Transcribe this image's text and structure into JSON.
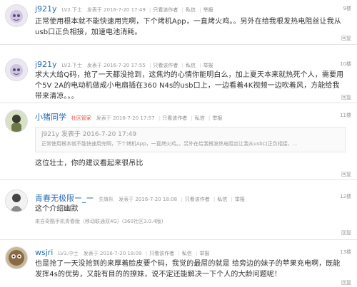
{
  "actions": {
    "only_author": "只看该作者",
    "pm": "私信",
    "report": "举报",
    "reply": "回复"
  },
  "posts": [
    {
      "username": "j921y",
      "level": "LV2.下士",
      "time": "发表于 2016-7-20 17:49",
      "floor": "9楼",
      "content": "正常使用根本就不能快速用完啊，下个烤机App，一直烤火鸡。。另外在给我根发热电阻丝让我从usb口正负相接，加速电池消耗。"
    },
    {
      "username": "j921y",
      "level": "LV2.下士",
      "time": "发表于 2016-7-20 17:55",
      "floor": "10楼",
      "content": "求大大给Q码，抢了一天都没抢到，这焦灼的心情你能明白么，加上夏天本来就热死个人，需要用个5V 2A的电动机做成小电扇插在360 N4s的usb口上，一边看着4K视频一边吹着风，方能给我带来清凉。。。"
    },
    {
      "username": "小猪同学",
      "badge": "社区管家",
      "time": "发表于 2016-7-20 17:57",
      "floor": "11楼",
      "quote_head": "j921y 发表于 2016-7-20 17:49",
      "quote_body": "正常使用根本就不能快速用完啊，下个烤机App，一直烤火鸡。。另外在给我根发热电阻丝让我从usb口正负相接，...",
      "content": "这位壮士，你的建议看起来很吊比"
    },
    {
      "username": "青春无极限ー_ー",
      "level": "先锋队",
      "time": "发表于 2016-7-20 18:08",
      "floor": "12楼",
      "content": "这个介绍幽默",
      "source": "来自奇酷手机青春版（移动联通双4G）(360社区3.0.4版)"
    },
    {
      "username": "wsjri",
      "level": "LV3.中士",
      "time": "发表于 2016-7-20 18:09",
      "floor": "13楼",
      "content": "也是抢了一天没抢到的来厚着脸皮要个码，我觉的最屌的就是 给旁边的妹子的苹果充电啊，既能发挥4s的优势，又能有目的的撩妹，说不定还能解决一下个人的大龄问题呢！"
    }
  ]
}
